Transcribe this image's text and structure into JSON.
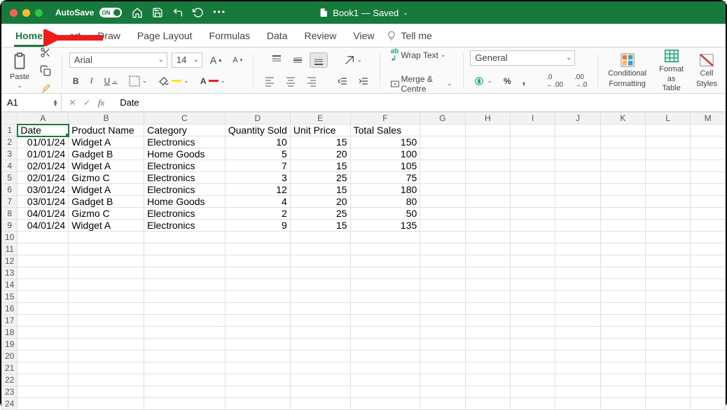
{
  "titlebar": {
    "autosave_label": "AutoSave",
    "switch_state": "ON",
    "doc_name": "Book1 — Saved"
  },
  "tabs": {
    "home": "Home",
    "insert": "ert",
    "draw": "Draw",
    "page_layout": "Page Layout",
    "formulas": "Formulas",
    "data": "Data",
    "review": "Review",
    "view": "View",
    "tell_me": "Tell me"
  },
  "ribbon": {
    "paste": "Paste",
    "font_name": "Arial",
    "font_size": "14",
    "wrap_text": "Wrap Text",
    "merge_centre": "Merge & Centre",
    "number_format": "General",
    "cond_fmt_l1": "Conditional",
    "cond_fmt_l2": "Formatting",
    "fmt_tbl_l1": "Format",
    "fmt_tbl_l2": "as Table",
    "cell_styles_l1": "Cell",
    "cell_styles_l2": "Styles"
  },
  "fx": {
    "namebox": "A1",
    "formula": "Date"
  },
  "columns": [
    "A",
    "B",
    "C",
    "D",
    "E",
    "F",
    "G",
    "H",
    "I",
    "J",
    "K",
    "L",
    "M"
  ],
  "sheet": {
    "headers": [
      "Date",
      "Product Name",
      "Category",
      "Quantity Sold",
      "Unit Price",
      "Total Sales"
    ],
    "rows": [
      {
        "date": "01/01/24",
        "product": "Widget A",
        "category": "Electronics",
        "qty": "10",
        "price": "15",
        "total": "150"
      },
      {
        "date": "01/01/24",
        "product": "Gadget B",
        "category": "Home Goods",
        "qty": "5",
        "price": "20",
        "total": "100"
      },
      {
        "date": "02/01/24",
        "product": "Widget A",
        "category": "Electronics",
        "qty": "7",
        "price": "15",
        "total": "105"
      },
      {
        "date": "02/01/24",
        "product": "Gizmo C",
        "category": "Electronics",
        "qty": "3",
        "price": "25",
        "total": "75"
      },
      {
        "date": "03/01/24",
        "product": "Widget A",
        "category": "Electronics",
        "qty": "12",
        "price": "15",
        "total": "180"
      },
      {
        "date": "03/01/24",
        "product": "Gadget B",
        "category": "Home Goods",
        "qty": "4",
        "price": "20",
        "total": "80"
      },
      {
        "date": "04/01/24",
        "product": "Gizmo C",
        "category": "Electronics",
        "qty": "2",
        "price": "25",
        "total": "50"
      },
      {
        "date": "04/01/24",
        "product": "Widget A",
        "category": "Electronics",
        "qty": "9",
        "price": "15",
        "total": "135"
      }
    ]
  }
}
